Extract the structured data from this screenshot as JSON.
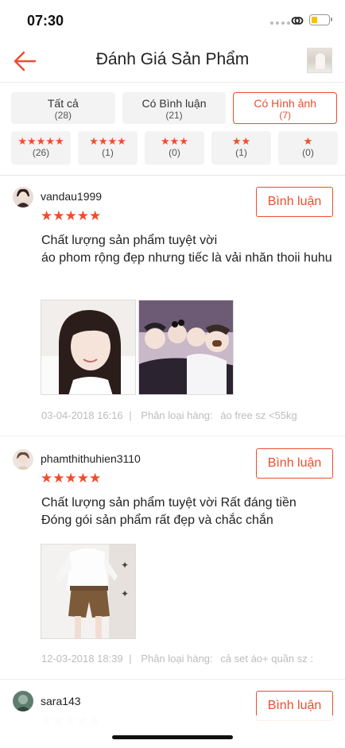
{
  "status_bar": {
    "time": "07:30"
  },
  "header": {
    "title": "Đánh Giá Sản Phẩm",
    "back_icon": "arrow-left-icon",
    "accent": "#ee4d2d"
  },
  "tabs": [
    {
      "label": "Tất cả",
      "count": "(28)"
    },
    {
      "label": "Có Bình luận",
      "count": "(21)"
    },
    {
      "label": "Có Hình ảnh",
      "count": "(7)",
      "active": true
    }
  ],
  "star_filters": [
    {
      "stars": "★★★★★",
      "count": "(26)"
    },
    {
      "stars": "★★★★",
      "count": "(1)"
    },
    {
      "stars": "★★★",
      "count": "(0)"
    },
    {
      "stars": "★★",
      "count": "(1)"
    },
    {
      "stars": "★",
      "count": "(0)"
    }
  ],
  "reviews": [
    {
      "username": "vandau1999",
      "stars": "★★★★★",
      "button": "Bình luận",
      "text_line1": "Chất lượng sản phẩm tuyệt vời",
      "text_line2": "áo phom rộng đẹp nhưng tiếc là vải nhăn thoii huhu",
      "date": "03-04-2018 16:16",
      "sep": "|",
      "variant_label": "Phân loại hàng:",
      "variant": "áo free sz <55kg"
    },
    {
      "username": "phamthithuhien3110",
      "stars": "★★★★★",
      "button": "Bình luận",
      "text_line1": "Chất lượng sản phẩm tuyệt vời  Rất đáng tiền",
      "text_line2": "Đóng gói sản phẩm rất đẹp và chắc chắn",
      "date": "12-03-2018 18:39",
      "sep": "|",
      "variant_label": "Phân loại hàng:",
      "variant": "cả set áo+ quần sz :"
    },
    {
      "username": "sara143",
      "stars": "★★★★★",
      "button": "Bình luận"
    }
  ]
}
